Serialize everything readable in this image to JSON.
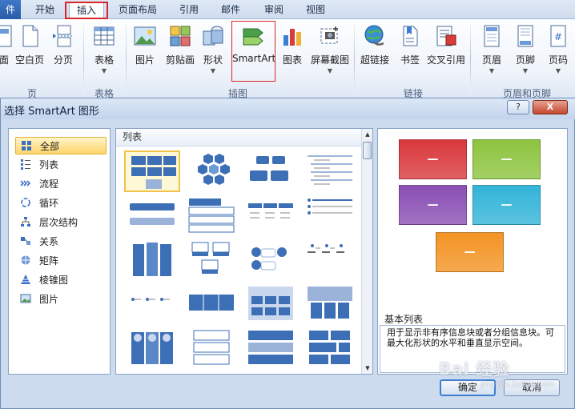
{
  "ribbon": {
    "tabs": [
      {
        "label": "件"
      },
      {
        "label": "开始"
      },
      {
        "label": "插入",
        "active": true
      },
      {
        "label": "页面布局"
      },
      {
        "label": "引用"
      },
      {
        "label": "邮件"
      },
      {
        "label": "审阅"
      },
      {
        "label": "视图"
      }
    ],
    "buttons": [
      {
        "label": "面",
        "icon": "cover-page-icon"
      },
      {
        "label": "空白页",
        "icon": "blank-page-icon"
      },
      {
        "label": "分页",
        "icon": "page-break-icon"
      },
      {
        "label": "表格",
        "icon": "table-icon",
        "dropdown": true
      },
      {
        "label": "图片",
        "icon": "picture-icon"
      },
      {
        "label": "剪贴画",
        "icon": "clipart-icon"
      },
      {
        "label": "形状",
        "icon": "shapes-icon",
        "dropdown": true
      },
      {
        "label": "SmartArt",
        "icon": "smartart-icon"
      },
      {
        "label": "图表",
        "icon": "chart-icon"
      },
      {
        "label": "屏幕截图",
        "icon": "screenshot-icon",
        "dropdown": true
      },
      {
        "label": "超链接",
        "icon": "hyperlink-icon"
      },
      {
        "label": "书签",
        "icon": "bookmark-icon"
      },
      {
        "label": "交叉引用",
        "icon": "cross-reference-icon"
      },
      {
        "label": "页眉",
        "icon": "header-icon",
        "dropdown": true
      },
      {
        "label": "页脚",
        "icon": "footer-icon",
        "dropdown": true
      },
      {
        "label": "页码",
        "icon": "page-number-icon",
        "dropdown": true
      }
    ],
    "groups": [
      {
        "label": "页"
      },
      {
        "label": "表格"
      },
      {
        "label": "插图"
      },
      {
        "label": "链接"
      },
      {
        "label": "页眉和页脚"
      }
    ]
  },
  "dialog": {
    "title": "选择 SmartArt 图形",
    "help_label": "?",
    "close_label": "X",
    "categories": [
      {
        "label": "全部",
        "icon": "grid-icon",
        "selected": true
      },
      {
        "label": "列表",
        "icon": "list-icon"
      },
      {
        "label": "流程",
        "icon": "process-icon"
      },
      {
        "label": "循环",
        "icon": "cycle-icon"
      },
      {
        "label": "层次结构",
        "icon": "hierarchy-icon"
      },
      {
        "label": "关系",
        "icon": "relationship-icon"
      },
      {
        "label": "矩阵",
        "icon": "matrix-icon"
      },
      {
        "label": "棱锥图",
        "icon": "pyramid-icon"
      },
      {
        "label": "图片",
        "icon": "picture-icon"
      }
    ],
    "gallery_header": "列表",
    "preview_title": "基本列表",
    "preview_description": "用于显示非有序信息块或者分组信息块。可最大化形状的水平和垂直显示空间。",
    "preview_block_label": "—",
    "preview_colors": [
      "#d9383c",
      "#8dc43f",
      "#8a4fb4",
      "#32b4d8",
      "#f39424"
    ],
    "ok_label": "确定",
    "cancel_label": "取消"
  },
  "watermark": {
    "text": "Bai 经验",
    "sub": "jingyan.baidu.com"
  }
}
